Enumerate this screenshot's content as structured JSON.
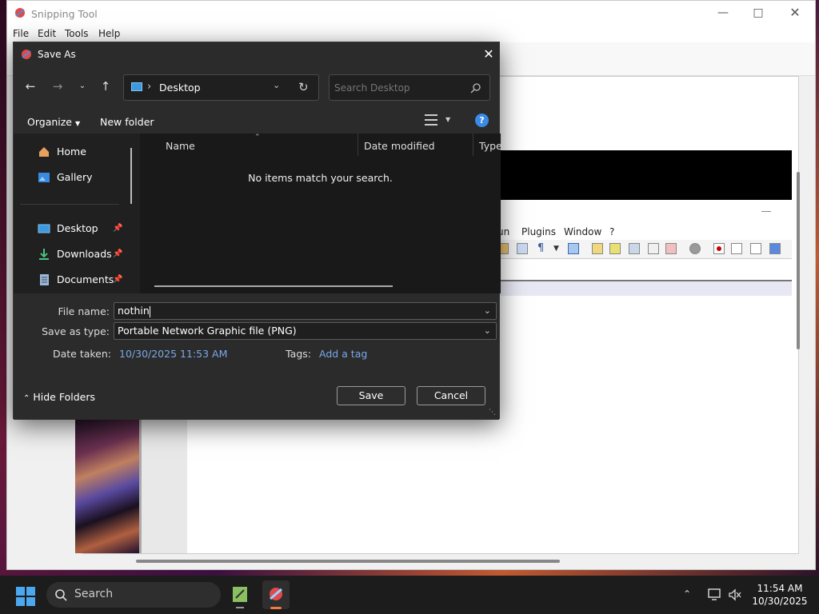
{
  "app": {
    "title": "Snipping Tool",
    "menu": [
      "File",
      "Edit",
      "Tools",
      "Help"
    ]
  },
  "nested": {
    "menu": [
      "un",
      "Plugins",
      "Window",
      "?"
    ]
  },
  "dialog": {
    "title": "Save As",
    "address": {
      "sep": "›",
      "location": "Desktop"
    },
    "search": {
      "placeholder": "Search Desktop"
    },
    "organize": "Organize",
    "new_folder": "New folder",
    "help": "?",
    "sidebar": [
      {
        "label": "Home",
        "icon": "home-icon"
      },
      {
        "label": "Gallery",
        "icon": "gallery-icon"
      },
      {
        "label": "Desktop",
        "icon": "desktop-icon",
        "pinned": true,
        "selected": true
      },
      {
        "label": "Downloads",
        "icon": "download-icon",
        "pinned": true
      },
      {
        "label": "Documents",
        "icon": "documents-icon",
        "pinned": true
      }
    ],
    "columns": [
      "Name",
      "Date modified",
      "Type"
    ],
    "empty": "No items match your search.",
    "file_name_label": "File name:",
    "file_name_value": "nothin",
    "save_type_label": "Save as type:",
    "save_type_value": "Portable Network Graphic file (PNG)",
    "date_taken_label": "Date taken:",
    "date_taken_value": "10/30/2025 11:53 AM",
    "tags_label": "Tags:",
    "tags_value": "Add a tag",
    "hide_folders": "Hide Folders",
    "save": "Save",
    "cancel": "Cancel"
  },
  "taskbar": {
    "search": "Search",
    "time": "11:54 AM",
    "date": "10/30/2025"
  }
}
